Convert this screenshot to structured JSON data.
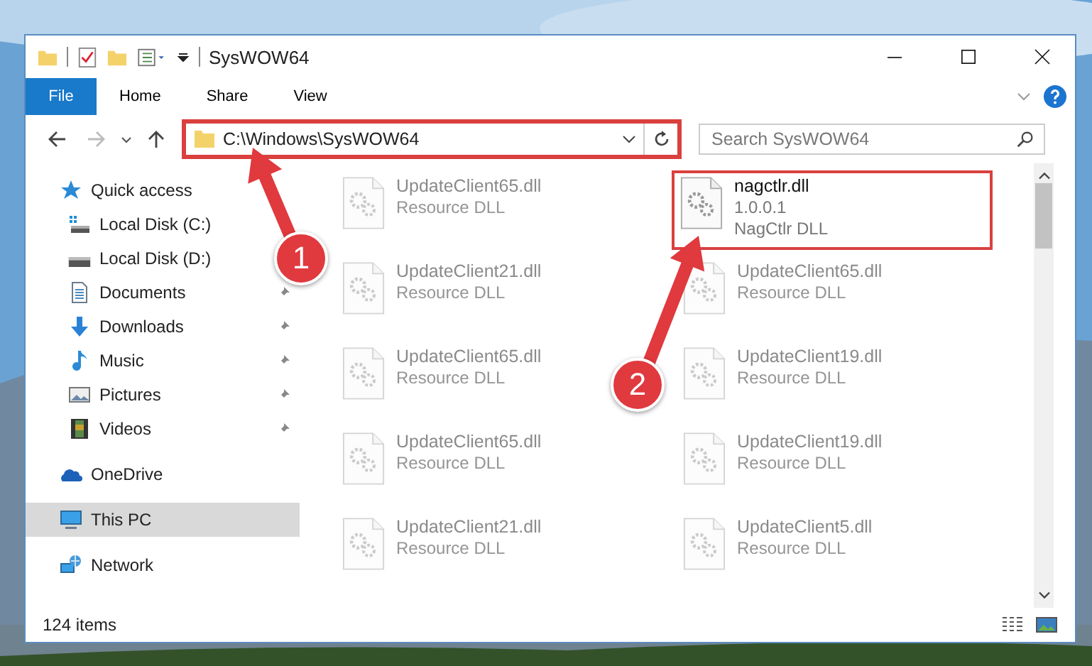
{
  "window": {
    "title": "SysWOW64"
  },
  "file_tab": {
    "label": "File"
  },
  "ribbon_tabs": [
    {
      "label": "Home"
    },
    {
      "label": "Share"
    },
    {
      "label": "View"
    }
  ],
  "address": {
    "path": "C:\\Windows\\SysWOW64",
    "highlighted": true
  },
  "search": {
    "placeholder": "Search SysWOW64"
  },
  "sidebar": {
    "items": [
      {
        "label": "Quick access",
        "kind": "star",
        "selected": false,
        "children": [
          {
            "label": "Local Disk (C:)",
            "kind": "system-drive",
            "pinned": false
          },
          {
            "label": "Local Disk (D:)",
            "kind": "drive",
            "pinned": false
          },
          {
            "label": "Documents",
            "kind": "documents",
            "pinned": true
          },
          {
            "label": "Downloads",
            "kind": "downloads",
            "pinned": true
          },
          {
            "label": "Music",
            "kind": "music",
            "pinned": true
          },
          {
            "label": "Pictures",
            "kind": "pictures",
            "pinned": true
          },
          {
            "label": "Videos",
            "kind": "videos",
            "pinned": true
          }
        ]
      },
      {
        "label": "OneDrive",
        "kind": "cloud",
        "selected": false
      },
      {
        "label": "This PC",
        "kind": "computer",
        "selected": true
      },
      {
        "label": "Network",
        "kind": "network",
        "selected": false
      }
    ]
  },
  "files": [
    {
      "name": "UpdateClient65.dll",
      "details": [
        "Resource DLL"
      ],
      "blurred": true,
      "highlighted": false
    },
    {
      "name": "nagctlr.dll",
      "details": [
        "1.0.0.1",
        "NagCtlr DLL"
      ],
      "blurred": false,
      "highlighted": true
    },
    {
      "name": "UpdateClient21.dll",
      "details": [
        "Resource DLL"
      ],
      "blurred": true,
      "highlighted": false
    },
    {
      "name": "UpdateClient65.dll",
      "details": [
        "Resource DLL"
      ],
      "blurred": true,
      "highlighted": false
    },
    {
      "name": "UpdateClient65.dll",
      "details": [
        "Resource DLL"
      ],
      "blurred": true,
      "highlighted": false
    },
    {
      "name": "UpdateClient19.dll",
      "details": [
        "Resource DLL"
      ],
      "blurred": true,
      "highlighted": false
    },
    {
      "name": "UpdateClient65.dll",
      "details": [
        "Resource DLL"
      ],
      "blurred": true,
      "highlighted": false
    },
    {
      "name": "UpdateClient19.dll",
      "details": [
        "Resource DLL"
      ],
      "blurred": true,
      "highlighted": false
    },
    {
      "name": "UpdateClient21.dll",
      "details": [
        "Resource DLL"
      ],
      "blurred": true,
      "highlighted": false
    },
    {
      "name": "UpdateClient5.dll",
      "details": [
        "Resource DLL"
      ],
      "blurred": true,
      "highlighted": false
    }
  ],
  "status_bar": {
    "item_count": "124 items"
  },
  "annotations": [
    {
      "number": "1"
    },
    {
      "number": "2"
    }
  ]
}
